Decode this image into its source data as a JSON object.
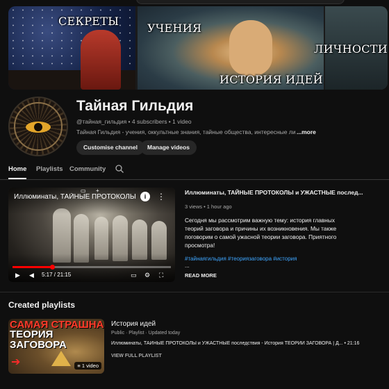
{
  "banner": {
    "labels": [
      "СЕКРЕТЫ",
      "УЧЕНИЯ",
      "ЛИЧНОСТИ",
      "ИСТОРИЯ ИДЕЙ"
    ]
  },
  "channel": {
    "name": "Тайная Гильдия",
    "handle": "@тайная_гильдия",
    "subscribers": "4 subscribers",
    "videos": "1 video",
    "meta_line": "@тайная_гильдия • 4 subscribers • 1 video",
    "description": "Тайная Гильдия - учения, оккультные знания, тайные общества, интересные личнос",
    "more_label": "...more",
    "customise_label": "Customise channel",
    "manage_label": "Manage videos"
  },
  "tabs": [
    {
      "label": "Home",
      "active": true
    },
    {
      "label": "Playlists",
      "active": false
    },
    {
      "label": "Community",
      "active": false
    }
  ],
  "featured_video": {
    "player_title": "Иллюминаты, ТАЙНЫЕ ПРОТОКОЛЫ",
    "title": "Иллюминаты, ТАЙНЫЕ ПРОТОКОЛЫ и УЖАСТНЫЕ послед...",
    "views": "3 views",
    "age": "1 hour ago",
    "meta_line": "3 views • 1 hour ago",
    "description": "Сегодня мы рассмотрим важную тему: история главных теорий заговора и причины их возникновения. Мы также поговорим о самой ужасной теории заговора. Приятного просмотра!",
    "tags": "#тайнаягильдия #теориязаговора #история",
    "ellipsis": "...",
    "read_more": "READ MORE",
    "time": "5:17 / 21:15",
    "progress": 0.25
  },
  "playlists_section": {
    "title": "Created playlists",
    "items": [
      {
        "thumb_line1": "САМАЯ СТРАШНАЯ",
        "thumb_line2": "ТЕОРИЯ",
        "thumb_line3": "ЗАГОВОРА",
        "count": "1 video",
        "title": "История идей",
        "meta": "Public · Playlist · Updated today",
        "video_line": "Иллюминаты, ТАЙНЫЕ ПРОТОКОЛЫ и УЖАСТНЫЕ последствия - История ТЕОРИЙ ЗАГОВОРА | Д... • 21:16",
        "view_full": "VIEW FULL PLAYLIST"
      }
    ]
  },
  "colors": {
    "background": "#0f0f0f",
    "text": "#f1f1f1",
    "muted": "#aaaaaa",
    "button": "#272727",
    "link": "#3ea6ff",
    "progress": "#ff0000"
  }
}
